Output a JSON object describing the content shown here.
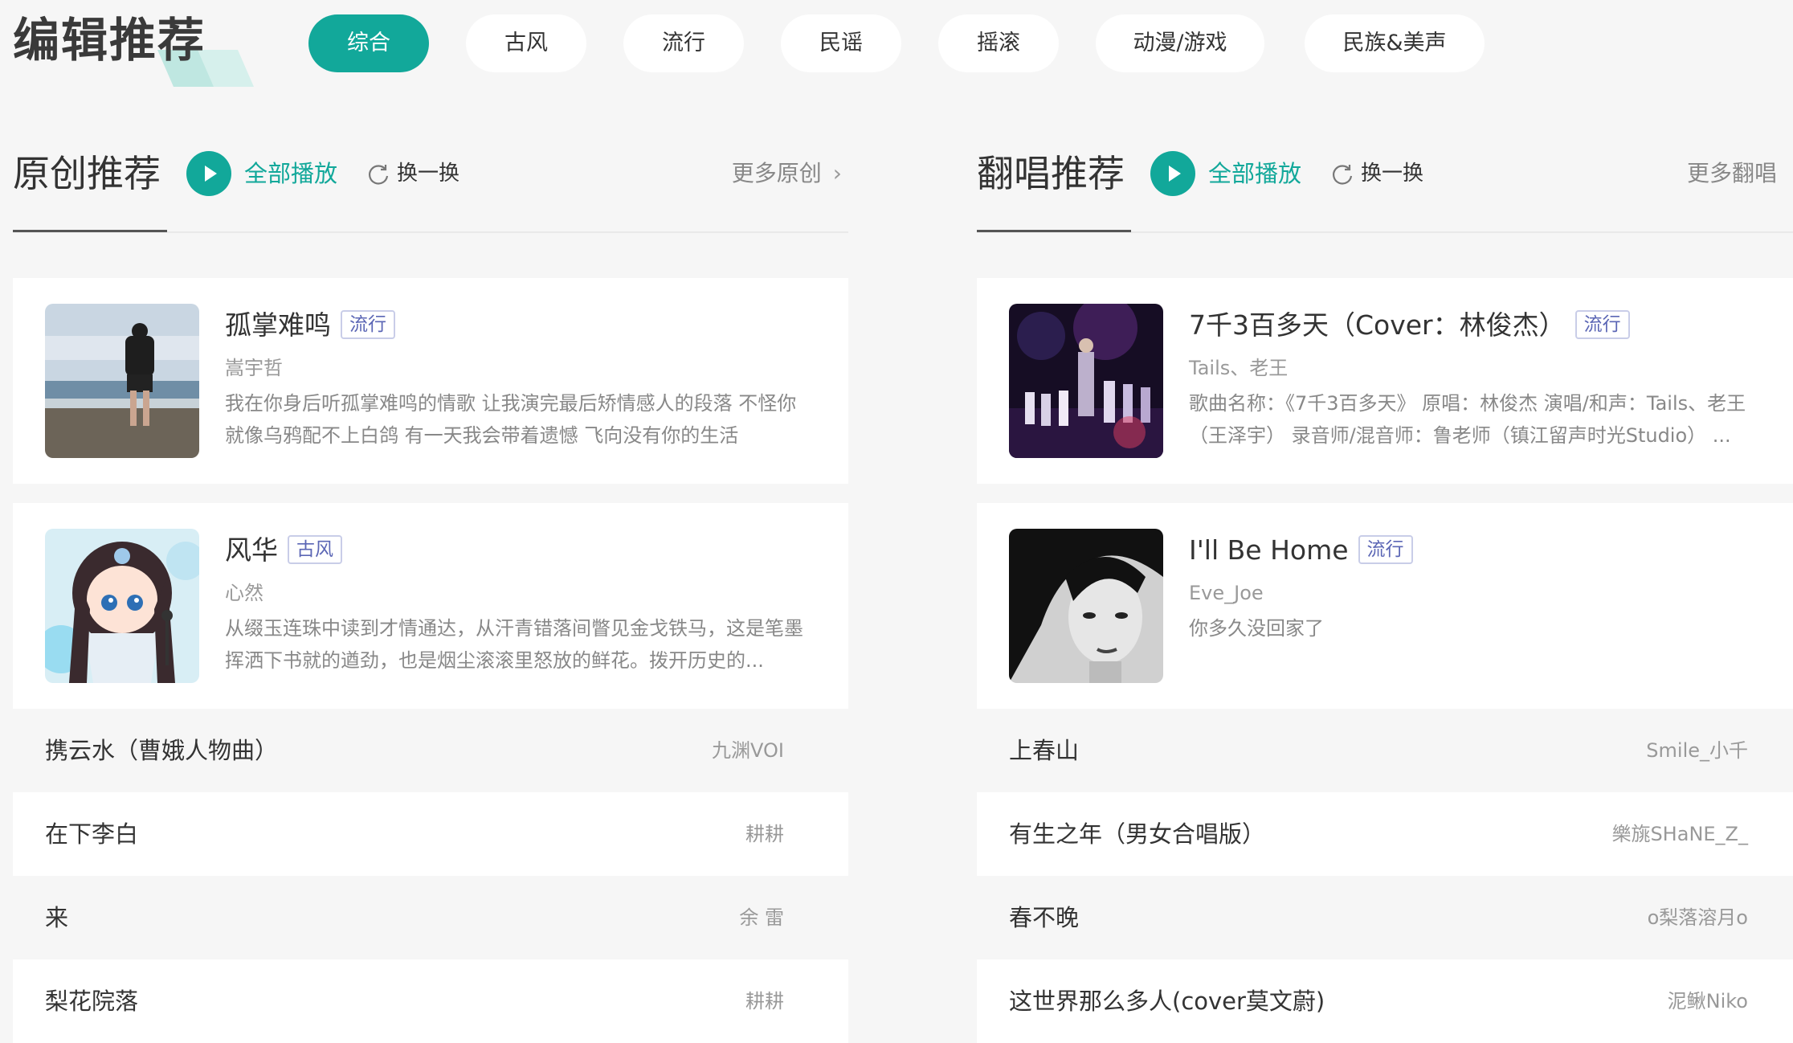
{
  "brand": {
    "title": "编辑推荐",
    "accent_color": "#12a89a"
  },
  "tabs": [
    {
      "label": "综合",
      "active": true
    },
    {
      "label": "古风"
    },
    {
      "label": "流行"
    },
    {
      "label": "民谣"
    },
    {
      "label": "摇滚"
    },
    {
      "label": "动漫/游戏"
    },
    {
      "label": "民族&美声"
    }
  ],
  "original": {
    "title": "原创推荐",
    "play_all": "全部播放",
    "refresh": "换一换",
    "more": "更多原创",
    "more_chevron": "›",
    "cards": [
      {
        "title": "孤掌难鸣",
        "tag": "流行",
        "artist": "嵩宇哲",
        "desc": "我在你身后听孤掌难鸣的情歌 让我演完最后矫情感人的段落 不怪你就像乌鸦配不上白鸽 有一天我会带着遗憾 飞向没有你的生活",
        "cover": "man-on-beach"
      },
      {
        "title": "风华",
        "tag": "古风",
        "artist": "心然",
        "desc": "从缀玉连珠中读到才情通达，从汗青错落间瞥见金戈铁马，这是笔墨挥洒下书就的遒劲，也是烟尘滚滚里怒放的鲜花。拨开历史的...",
        "cover": "chibi-singer"
      }
    ],
    "list": [
      {
        "title": "携云水（曹娥人物曲）",
        "artist": "九渊VOI"
      },
      {
        "title": "在下李白",
        "artist": "耕耕"
      },
      {
        "title": "来",
        "artist": "余 雷"
      },
      {
        "title": "梨花院落",
        "artist": "耕耕"
      }
    ]
  },
  "cover_songs": {
    "title": "翻唱推荐",
    "play_all": "全部播放",
    "refresh": "换一换",
    "more": "更多翻唱",
    "cards": [
      {
        "title": "7千3百多天（Cover：林俊杰）",
        "tag": "流行",
        "artist": "Tails、老王",
        "desc": "歌曲名称：《7千3百多天》 原唱：林俊杰 演唱/和声：Tails、老王（王泽宇） 录音师/混音师：鲁老师（镇江留声时光Studio） ...",
        "cover": "concert-stage"
      },
      {
        "title": "I'll Be Home",
        "tag": "流行",
        "artist": "Eve_Joe",
        "desc": "你多久没回家了",
        "cover": "bw-portrait"
      }
    ],
    "list": [
      {
        "title": "上春山",
        "artist": "Smile_小千"
      },
      {
        "title": "有生之年（男女合唱版）",
        "artist": "樂旐SHaNE_Z_"
      },
      {
        "title": "春不晚",
        "artist": "o梨落溶月o"
      },
      {
        "title": "这世界那么多人(cover莫文蔚)",
        "artist": "泥鳅Niko"
      }
    ]
  }
}
